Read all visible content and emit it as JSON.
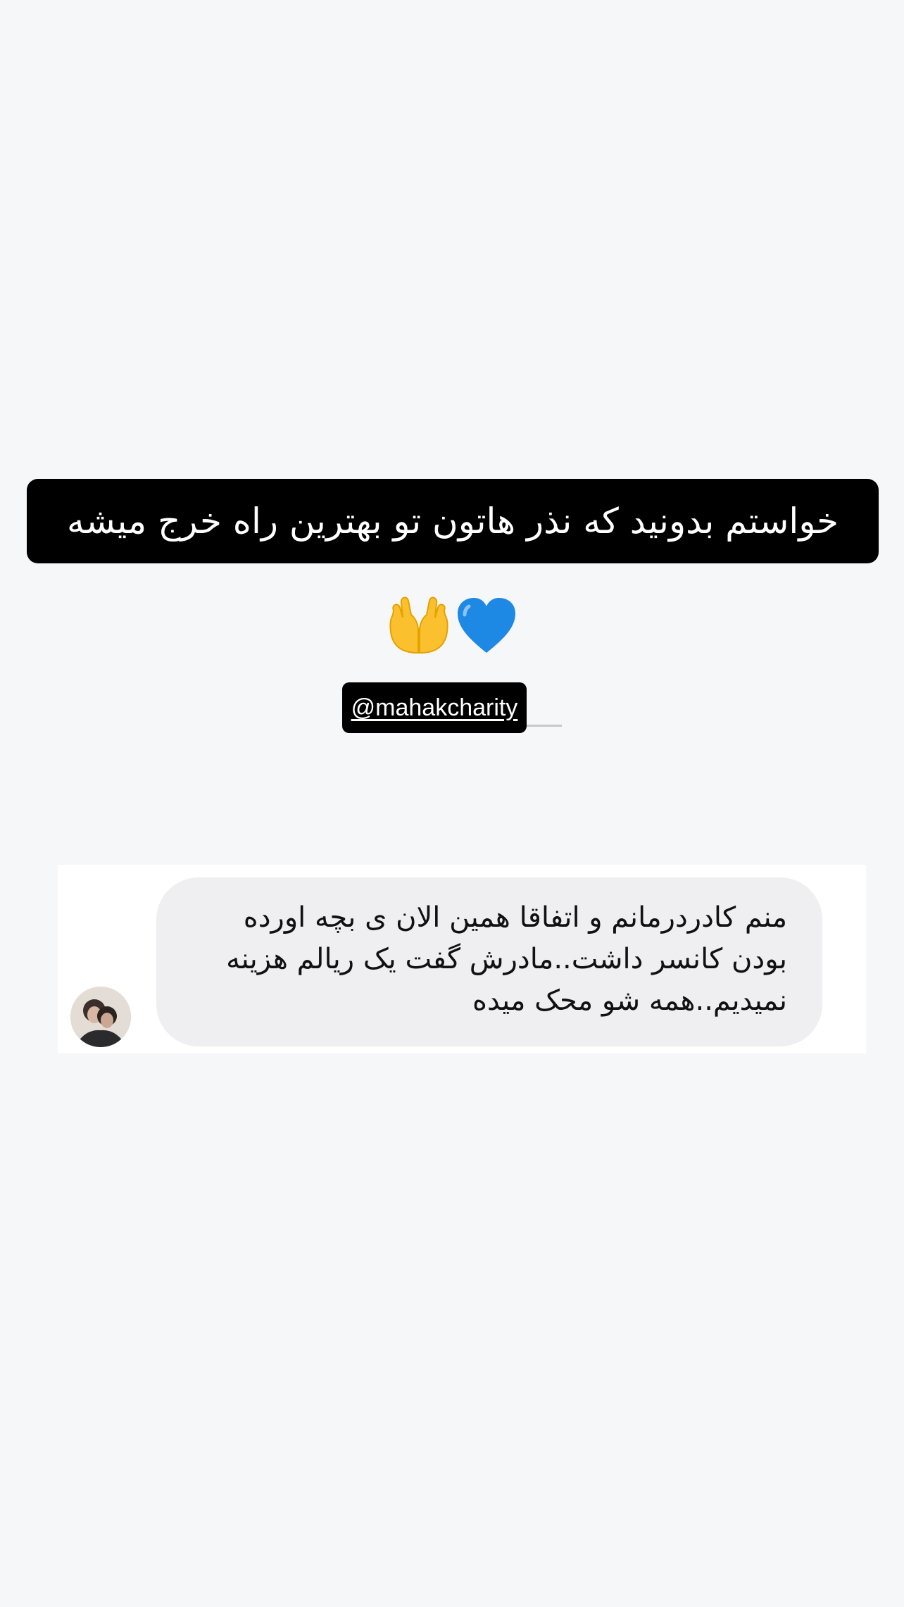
{
  "story": {
    "headline": "خواستم بدونید که نذر هاتون تو بهترین راه خرج میشه",
    "emojis": [
      "palms-up-together-emoji",
      "blue-heart-emoji"
    ],
    "mention": "@mahakcharity"
  },
  "message": {
    "text": "منم کادردرمانم و اتفاقا همین الان ی بچه اورده بودن کانسر داشت..مادرش گفت یک ریالم هزینه نمیدیم..همه شو محک میده"
  },
  "colors": {
    "background": "#f6f7f9",
    "headline_bg": "#000000",
    "bubble_bg": "#efeff2",
    "heart": "#1e88e5",
    "palms": "#fbc02d"
  }
}
